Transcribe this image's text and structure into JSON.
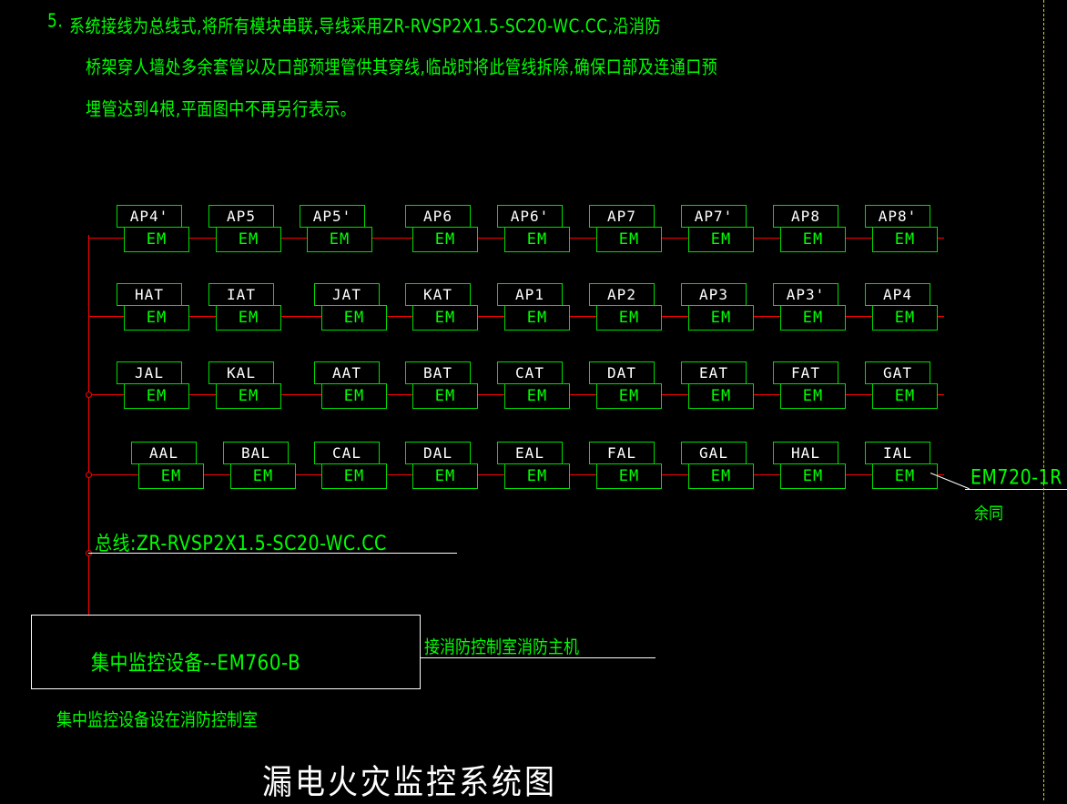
{
  "notes": {
    "number": "5.",
    "line1": "系统接线为总线式,将所有模块串联,导线采用ZR-RVSP2X1.5-SC20-WC.CC,沿消防",
    "line2": "桥架穿人墙处多余套管以及口部预埋管供其穿线,临战时将此管线拆除,确保口部及连通口预",
    "line3": "埋管达到4根,平面图中不再另行表示。"
  },
  "module_label": "EM",
  "rows": [
    {
      "id": "row-1",
      "units": [
        "AP4'",
        "AP5",
        "AP5'",
        "AP6",
        "AP6'",
        "AP7",
        "AP7'",
        "AP8",
        "AP8'"
      ]
    },
    {
      "id": "row-2",
      "units": [
        "HAT",
        "IAT",
        "JAT",
        "KAT",
        "AP1",
        "AP2",
        "AP3",
        "AP3'",
        "AP4"
      ]
    },
    {
      "id": "row-3",
      "units": [
        "JAL",
        "KAL",
        "AAT",
        "BAT",
        "CAT",
        "DAT",
        "EAT",
        "FAT",
        "GAT"
      ]
    },
    {
      "id": "row-4",
      "units": [
        "AAL",
        "BAL",
        "CAL",
        "DAL",
        "EAL",
        "FAL",
        "GAL",
        "HAL",
        "IAL"
      ]
    }
  ],
  "annotations": {
    "bus_cable": "总线:ZR-RVSP2X1.5-SC20-WC.CC",
    "device_model": "EM720-1R",
    "device_same": "余同",
    "to_fire_host": "接消防控制室消防主机",
    "central_note": "集中监控设备设在消防控制室"
  },
  "main_equipment": {
    "label": "集中监控设备--EM760-B"
  },
  "title": "漏电火灾监控系统图",
  "colors": {
    "background": "#000000",
    "box_border": "#00dd00",
    "module_text": "#00ff00",
    "unit_label_text": "#ffffff",
    "wire": "#ff0000",
    "leader": "#ffffff",
    "dashed_border": "#d8d800",
    "title_text": "#ffffff"
  }
}
